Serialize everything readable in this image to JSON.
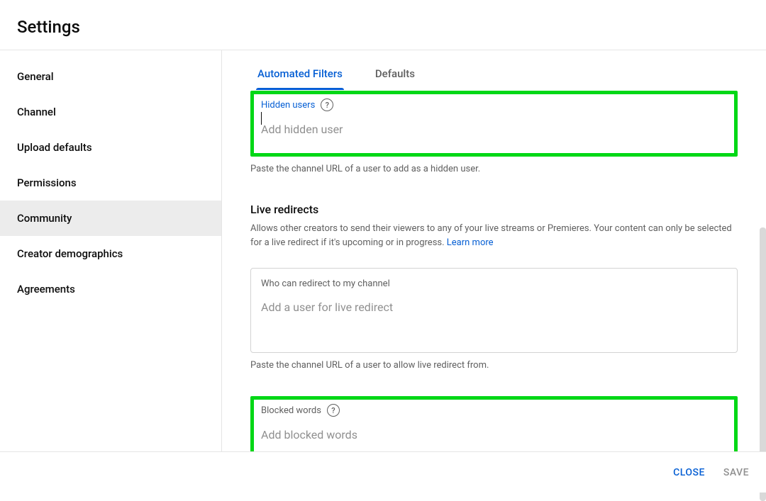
{
  "header": {
    "title": "Settings"
  },
  "sidebar": {
    "items": [
      {
        "label": "General",
        "active": false
      },
      {
        "label": "Channel",
        "active": false
      },
      {
        "label": "Upload defaults",
        "active": false
      },
      {
        "label": "Permissions",
        "active": false
      },
      {
        "label": "Community",
        "active": true
      },
      {
        "label": "Creator demographics",
        "active": false
      },
      {
        "label": "Agreements",
        "active": false
      }
    ]
  },
  "tabs": {
    "automated_filters": "Automated Filters",
    "defaults": "Defaults"
  },
  "hidden_users": {
    "label": "Hidden users",
    "placeholder": "Add hidden user",
    "helper": "Paste the channel URL of a user to add as a hidden user."
  },
  "live_redirects": {
    "title": "Live redirects",
    "description": "Allows other creators to send their viewers to any of your live streams or Premieres. Your content can only be selected for a live redirect if it's upcoming or in progress. ",
    "learn_more": "Learn more",
    "field_label": "Who can redirect to my channel",
    "placeholder": "Add a user for live redirect",
    "helper": "Paste the channel URL of a user to allow live redirect from."
  },
  "blocked_words": {
    "label": "Blocked words",
    "placeholder": "Add blocked words"
  },
  "footer": {
    "close": "CLOSE",
    "save": "SAVE"
  }
}
